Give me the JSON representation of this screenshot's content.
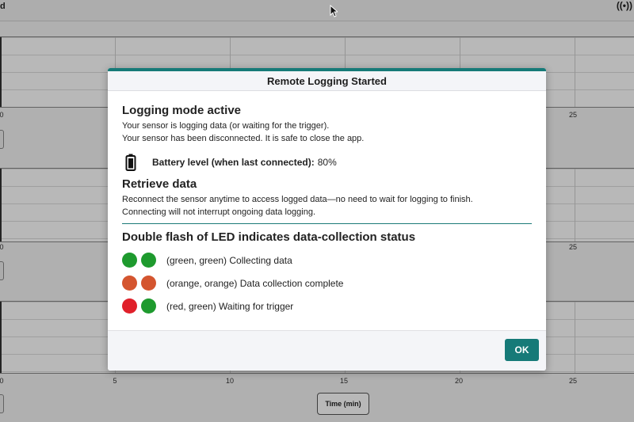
{
  "app": {
    "corner_letter": "d",
    "wireless_glyph": "((•))",
    "time_button_label": "Time (min)",
    "x_ticks": [
      "0",
      "5",
      "10",
      "15",
      "20",
      "25"
    ]
  },
  "modal": {
    "title": "Remote Logging Started",
    "logging": {
      "heading": "Logging mode active",
      "line1": "Your sensor is logging data (or waiting for the trigger).",
      "line2": "Your sensor has been disconnected. It is safe to close the app."
    },
    "battery": {
      "label": "Battery level (when last connected):",
      "value": "80%",
      "icon": "battery-icon"
    },
    "retrieve": {
      "heading": "Retrieve data",
      "line1": "Reconnect the sensor anytime to access logged data—no need to wait for logging to finish.",
      "line2": "Connecting will not interrupt ongoing data logging."
    },
    "led": {
      "heading": "Double flash of LED indicates data-collection status",
      "rows": [
        {
          "text": "(green, green) Collecting data",
          "colors": [
            "#1e9a2e",
            "#1e9a2e"
          ]
        },
        {
          "text": "(orange, orange) Data collection complete",
          "colors": [
            "#d4552f",
            "#d4552f"
          ]
        },
        {
          "text": "(red, green) Waiting for trigger",
          "colors": [
            "#e0202a",
            "#1e9a2e"
          ]
        }
      ]
    },
    "ok_label": "OK",
    "accent_color": "#167a78"
  }
}
